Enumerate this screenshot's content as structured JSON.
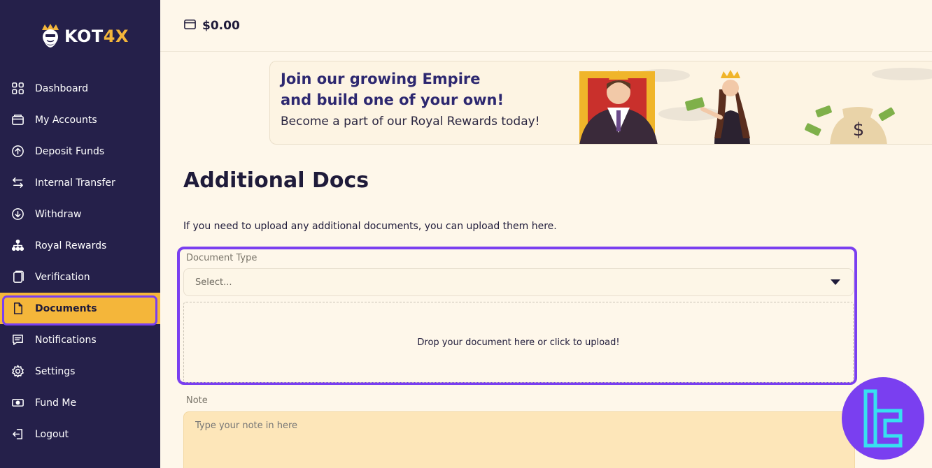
{
  "brand": {
    "name_main": "KOT",
    "name_accent": "4X"
  },
  "header": {
    "balance": "$0.00"
  },
  "sidebar": {
    "items": [
      {
        "label": "Dashboard",
        "icon": "grid-icon"
      },
      {
        "label": "My Accounts",
        "icon": "wallet-icon"
      },
      {
        "label": "Deposit Funds",
        "icon": "arrow-up-circle-icon"
      },
      {
        "label": "Internal Transfer",
        "icon": "transfer-arrows-icon"
      },
      {
        "label": "Withdraw",
        "icon": "arrow-down-circle-icon"
      },
      {
        "label": "Royal Rewards",
        "icon": "network-icon"
      },
      {
        "label": "Verification",
        "icon": "id-card-icon"
      },
      {
        "label": "Documents",
        "icon": "document-icon",
        "active": true
      },
      {
        "label": "Notifications",
        "icon": "message-icon"
      },
      {
        "label": "Settings",
        "icon": "gear-icon"
      },
      {
        "label": "Fund Me",
        "icon": "cash-icon"
      },
      {
        "label": "Logout",
        "icon": "logout-icon"
      }
    ]
  },
  "banner": {
    "line1": "Join our growing Empire",
    "line2": "and build one of your own!",
    "subtitle": "Become a part of our Royal Rewards today!",
    "money_symbol": "$"
  },
  "main": {
    "title": "Additional Docs",
    "intro": "If you need to upload any additional documents, you can upload them here.",
    "document_type": {
      "label": "Document Type",
      "placeholder": "Select..."
    },
    "dropzone": "Drop your document here or click to upload!",
    "note": {
      "label": "Note",
      "placeholder": "Type your note in here"
    }
  },
  "colors": {
    "sidebar_bg": "#25204a",
    "accent": "#f4b63a",
    "highlight": "#7a3ff0",
    "page_bg": "#fef7ea",
    "badge_cyan": "#37e0f0"
  }
}
